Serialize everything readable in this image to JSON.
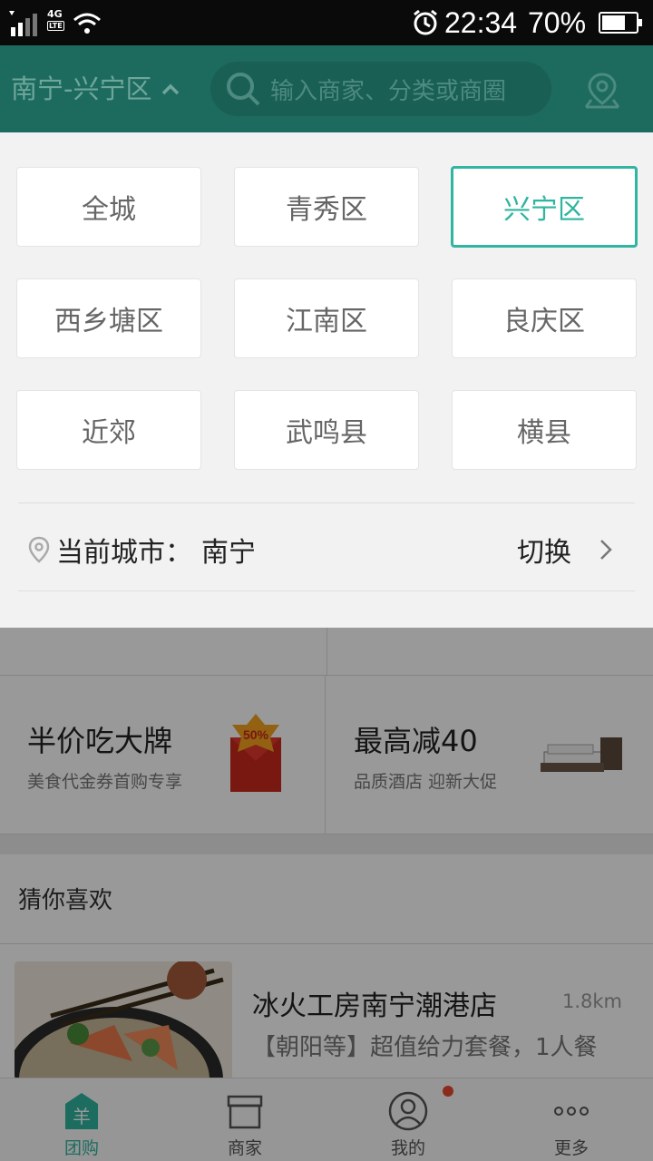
{
  "status_bar": {
    "network": "4G",
    "network_sub": "LTE",
    "time": "22:34",
    "battery": "70%",
    "battery_level": 0.7
  },
  "header": {
    "city_district": "南宁-兴宁区",
    "search_placeholder": "输入商家、分类或商圈"
  },
  "dropdown": {
    "districts": [
      {
        "label": "全城",
        "selected": false
      },
      {
        "label": "青秀区",
        "selected": false
      },
      {
        "label": "兴宁区",
        "selected": true
      },
      {
        "label": "西乡塘区",
        "selected": false
      },
      {
        "label": "江南区",
        "selected": false
      },
      {
        "label": "良庆区",
        "selected": false
      },
      {
        "label": "近郊",
        "selected": false
      },
      {
        "label": "武鸣县",
        "selected": false
      },
      {
        "label": "横县",
        "selected": false
      }
    ],
    "current_city_label": "当前城市：",
    "current_city": "南宁",
    "switch_label": "切换"
  },
  "background": {
    "promos": [
      {
        "title": "半价吃大牌",
        "subtitle": "美食代金券首购专享"
      },
      {
        "title": "最高减40",
        "subtitle": "品质酒店 迎新大促"
      }
    ],
    "guess_title": "猜你喜欢",
    "shop": {
      "name": "冰火工房南宁潮港店",
      "distance": "1.8km",
      "desc": "【朝阳等】超值给力套餐，1人餐"
    }
  },
  "bottom_nav": [
    {
      "label": "团购",
      "active": true
    },
    {
      "label": "商家",
      "active": false
    },
    {
      "label": "我的",
      "active": false
    },
    {
      "label": "更多",
      "active": false
    }
  ],
  "colors": {
    "accent": "#2fb5a0",
    "header": "#1c6b5e",
    "badge": "#e8492f"
  }
}
